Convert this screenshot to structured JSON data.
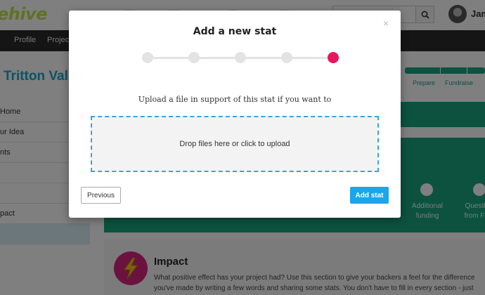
{
  "app": {
    "logo_text": "ehive",
    "user_name": "Jam"
  },
  "search": {
    "placeholder": ""
  },
  "nav": {
    "items": [
      "Profile",
      "Project"
    ]
  },
  "project": {
    "title": "Tritton Val"
  },
  "sidebar": {
    "items": [
      "Home",
      "ur Idea",
      "nts",
      "",
      "",
      "pact",
      ""
    ]
  },
  "stages": {
    "top_labels": [
      "Prepare",
      "Fundraise"
    ],
    "bottom_labels": [
      "Additional funding",
      "Questi from Fi"
    ]
  },
  "impact": {
    "title": "Impact",
    "description": "What positive effect has your project had? Use this section to give your backers a feel for the difference you've made by writing a few words and sharing some stats. You don't have to fill in every section - just choose the o"
  },
  "modal": {
    "title": "Add a new stat",
    "close_glyph": "×",
    "steps_total": 5,
    "current_step": 5,
    "prompt": "Upload a file in support of this stat if you want to",
    "dropzone_text": "Drop files here or click to upload",
    "previous_label": "Previous",
    "add_label": "Add stat"
  },
  "colors": {
    "accent_pink": "#e8155f",
    "button_blue": "#1aa6e8",
    "teal": "#19a47e",
    "dropzone_border": "#35a7d8"
  }
}
